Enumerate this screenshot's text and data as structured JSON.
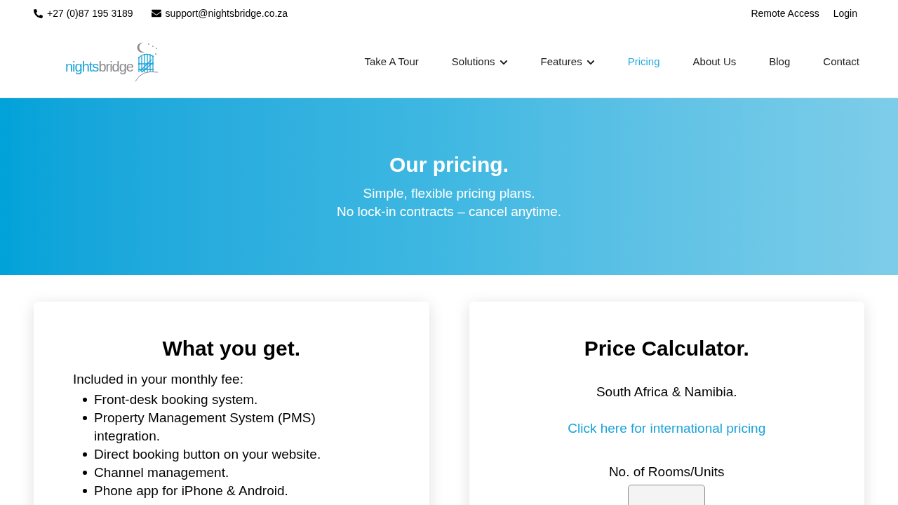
{
  "top_bar": {
    "contacts": [
      {
        "kind": "phone",
        "text": "+27 (0)87 195 3189"
      },
      {
        "kind": "email",
        "text": "support@nightsbridge.co.za"
      }
    ],
    "links": [
      "Remote Access",
      "Login"
    ]
  },
  "header": {
    "logo": {
      "lead": "nights",
      "tail": "bridge"
    },
    "nav": [
      {
        "label": "Take A Tour",
        "dropdown": false,
        "selected": false
      },
      {
        "label": "Solutions",
        "dropdown": true,
        "selected": false
      },
      {
        "label": "Features",
        "dropdown": true,
        "selected": false
      },
      {
        "label": "Pricing",
        "dropdown": false,
        "selected": true
      },
      {
        "label": "About Us",
        "dropdown": false,
        "selected": false
      },
      {
        "label": "Blog",
        "dropdown": false,
        "selected": false
      },
      {
        "label": "Contact",
        "dropdown": false,
        "selected": false
      }
    ]
  },
  "hero": {
    "title": "Our pricing.",
    "subtitle_lines": [
      "Simple, flexible pricing plans.",
      "No lock-in contracts – cancel anytime."
    ]
  },
  "features_card": {
    "title": "What you get.",
    "intro": "Included in your monthly fee:",
    "items": [
      "Front-desk booking system.",
      "Property Management System (PMS) integration.",
      "Direct booking button on your website.",
      "Channel management.",
      "Phone app for iPhone & Android."
    ]
  },
  "calculator_card": {
    "title": "Price Calculator.",
    "region": "South Africa & Namibia.",
    "international_link": "Click here for international pricing",
    "rooms_field": {
      "label": "No. of Rooms/Units"
    }
  }
}
